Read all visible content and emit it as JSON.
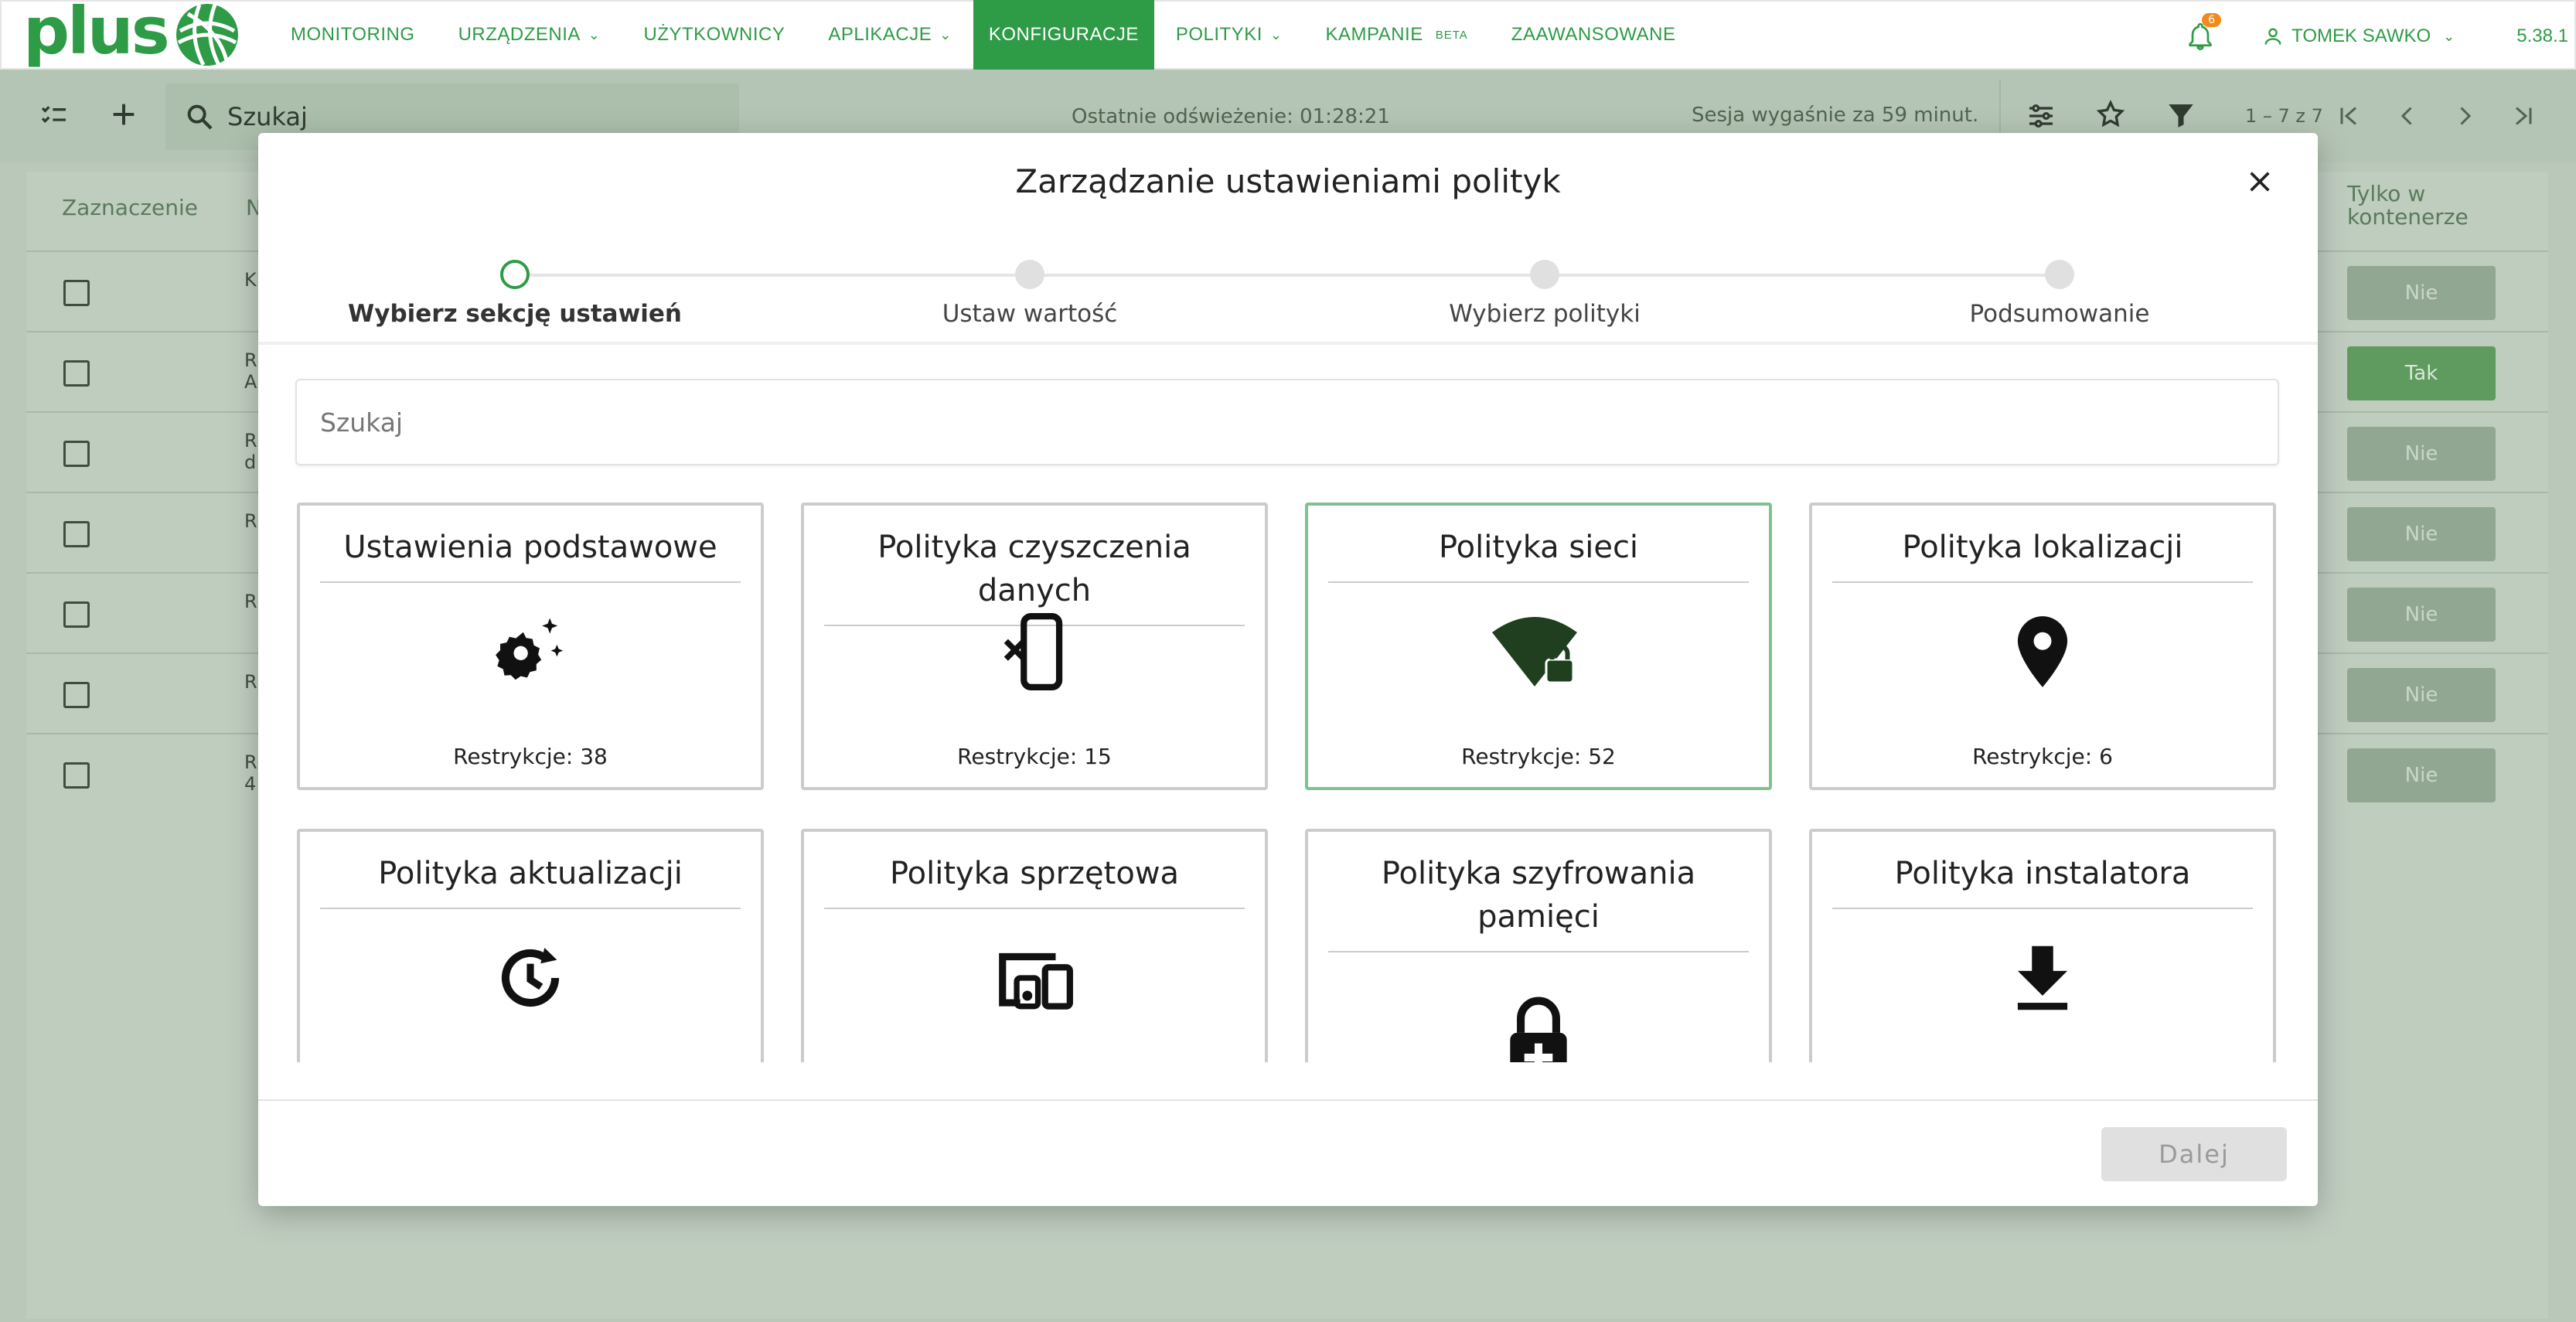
{
  "app": {
    "logo_text": "plus",
    "version": "5.38.1"
  },
  "nav": {
    "items": [
      {
        "label": "MONITORING",
        "has_dropdown": false
      },
      {
        "label": "URZĄDZENIA",
        "has_dropdown": true
      },
      {
        "label": "UŻYTKOWNICY",
        "has_dropdown": false
      },
      {
        "label": "APLIKACJE",
        "has_dropdown": true
      },
      {
        "label": "KONFIGURACJE",
        "has_dropdown": false,
        "active": true
      },
      {
        "label": "POLITYKI",
        "has_dropdown": true
      },
      {
        "label": "KAMPANIE",
        "badge": "BETA"
      },
      {
        "label": "ZAAWANSOWANE",
        "has_dropdown": false
      }
    ],
    "notifications_count": "6",
    "user_name": "TOMEK SAWKO"
  },
  "toolbar": {
    "search_text": "Szukaj",
    "last_refresh": "Ostatnie odświeżenie: 01:28:21",
    "session": "Sesja wygaśnie za 59 minut.",
    "range": "1 – 7 z 7"
  },
  "background_table": {
    "col_select": "Zaznaczenie",
    "col_partial": "N",
    "col_container": "Tylko w kontenerze",
    "rows": [
      {
        "name": "K",
        "container": "Nie"
      },
      {
        "name": "R\nA",
        "container": "Tak"
      },
      {
        "name": "R\nd",
        "container": "Nie"
      },
      {
        "name": "R",
        "container": "Nie"
      },
      {
        "name": "R",
        "container": "Nie"
      },
      {
        "name": "R",
        "container": "Nie"
      },
      {
        "name": "R\n4",
        "container": "Nie"
      }
    ]
  },
  "modal": {
    "title": "Zarządzanie ustawieniami polityk",
    "steps": [
      {
        "label": "Wybierz sekcję ustawień",
        "current": true
      },
      {
        "label": "Ustaw wartość",
        "current": false
      },
      {
        "label": "Wybierz polityki",
        "current": false
      },
      {
        "label": "Podsumowanie",
        "current": false
      }
    ],
    "search_placeholder": "Szukaj",
    "cards": [
      {
        "title": "Ustawienia podstawowe",
        "icon": "settings-sparkle-icon",
        "count": "Restrykcje: 38",
        "selected": false
      },
      {
        "title": "Polityka czyszczenia danych",
        "icon": "phone-wipe-icon",
        "count": "Restrykcje: 15",
        "selected": false
      },
      {
        "title": "Polityka sieci",
        "icon": "wifi-lock-icon",
        "count": "Restrykcje: 52",
        "selected": true
      },
      {
        "title": "Polityka lokalizacji",
        "icon": "location-pin-icon",
        "count": "Restrykcje: 6",
        "selected": false
      },
      {
        "title": "Polityka aktualizacji",
        "icon": "update-clock-icon",
        "count": "",
        "selected": false
      },
      {
        "title": "Polityka sprzętowa",
        "icon": "devices-icon",
        "count": "",
        "selected": false
      },
      {
        "title": "Polityka szyfrowania pamięci",
        "icon": "encrypted-lock-icon",
        "count": "",
        "selected": false
      },
      {
        "title": "Polityka instalatora",
        "icon": "download-icon",
        "count": "",
        "selected": false
      }
    ],
    "next_label": "Dalej"
  },
  "colors": {
    "brand_green": "#2e9b46",
    "selected_border": "#7ec28f",
    "badge_orange": "#f08a1c"
  }
}
